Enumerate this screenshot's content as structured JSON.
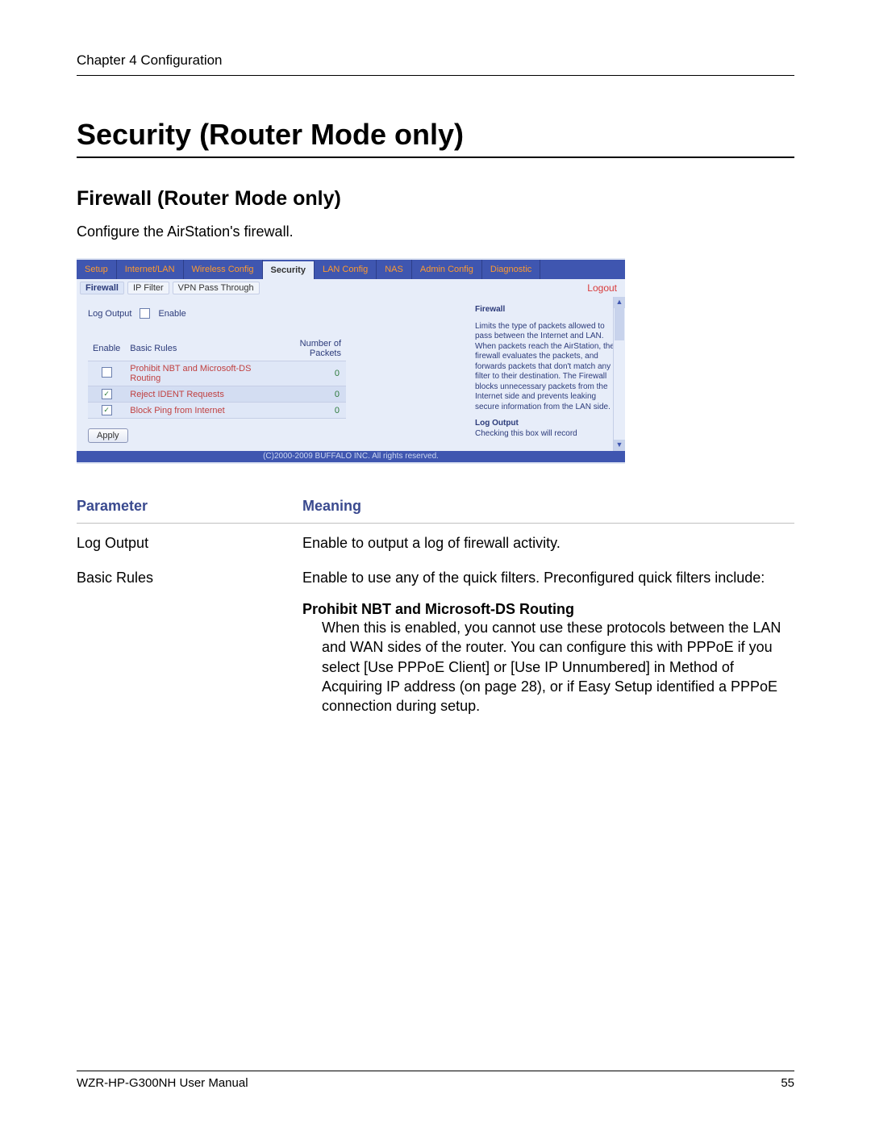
{
  "chapter": "Chapter 4  Configuration",
  "title": "Security (Router Mode only)",
  "subtitle": "Firewall (Router Mode only)",
  "description": "Configure the AirStation's firewall.",
  "ui": {
    "tabs": {
      "setup": "Setup",
      "internet_lan": "Internet/LAN",
      "wireless": "Wireless Config",
      "security": "Security",
      "lan": "LAN Config",
      "nas": "NAS",
      "admin": "Admin Config",
      "diag": "Diagnostic"
    },
    "subtabs": {
      "firewall": "Firewall",
      "ipfilter": "IP Filter",
      "vpn": "VPN Pass Through"
    },
    "logout": "Logout",
    "log_output_label": "Log Output",
    "enable_checkbox_label": "Enable",
    "table_headers": {
      "enable": "Enable",
      "basic": "Basic Rules",
      "packets": "Number of Packets"
    },
    "rules": [
      {
        "checked": false,
        "name": "Prohibit NBT and Microsoft-DS Routing",
        "packets": "0"
      },
      {
        "checked": true,
        "name": "Reject IDENT Requests",
        "packets": "0"
      },
      {
        "checked": true,
        "name": "Block Ping from Internet",
        "packets": "0"
      }
    ],
    "apply": "Apply",
    "help": {
      "title": "Firewall",
      "body": "Limits the type of packets allowed to pass between the Internet and LAN. When packets reach the AirStation, the firewall evaluates the packets, and forwards packets that don't match any filter to their destination. The Firewall blocks unnecessary packets from the Internet side and prevents leaking secure information from the LAN side.",
      "log_title": "Log Output",
      "log_body": "Checking this box will record"
    },
    "copyright": "(C)2000-2009 BUFFALO INC. All rights reserved."
  },
  "param_table": {
    "head_param": "Parameter",
    "head_meaning": "Meaning",
    "rows": {
      "log_output": {
        "param": "Log Output",
        "meaning": "Enable to output a log of firewall activity."
      },
      "basic_rules": {
        "param": "Basic Rules",
        "meaning": "Enable to use any of the quick filters. Preconfigured quick filters include:"
      }
    },
    "rule_detail": {
      "title": "Prohibit NBT and Microsoft-DS Routing",
      "body": "When this is enabled, you cannot use these protocols between the LAN and WAN sides of the router. You can configure this with PPPoE if you select [Use PPPoE Client] or [Use IP Unnumbered] in Method of Acquiring IP address (on page 28), or if Easy Setup identified a PPPoE connection during setup."
    }
  },
  "footer": {
    "manual": "WZR-HP-G300NH User Manual",
    "page": "55"
  }
}
